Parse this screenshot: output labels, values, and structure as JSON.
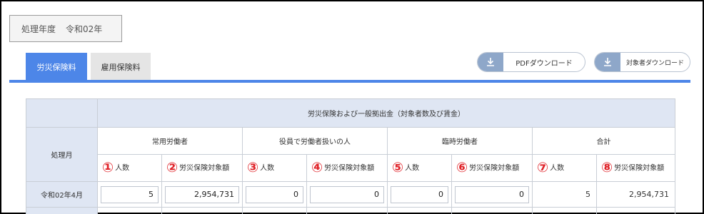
{
  "year_box": {
    "label": "処理年度",
    "value": "令和02年"
  },
  "tabs": [
    {
      "label": "労災保険料",
      "active": true
    },
    {
      "label": "雇用保険料",
      "active": false
    }
  ],
  "buttons": {
    "pdf_download": "PDFダウンロード",
    "target_download": "対象者ダウンロード"
  },
  "table": {
    "row_header": "処理月",
    "group_title": "労災保険および一般拠出金（対象者数及び賃金）",
    "groups": [
      "常用労働者",
      "役員で労働者扱いの人",
      "臨時労働者",
      "合計"
    ],
    "columns": [
      {
        "num": "①",
        "label": "人数"
      },
      {
        "num": "②",
        "label": "労災保険対象額"
      },
      {
        "num": "③",
        "label": "人数"
      },
      {
        "num": "④",
        "label": "労災保険対象額"
      },
      {
        "num": "⑤",
        "label": "人数"
      },
      {
        "num": "⑥",
        "label": "労災保険対象額"
      },
      {
        "num": "⑦",
        "label": "人数"
      },
      {
        "num": "⑧",
        "label": "労災保険対象額"
      }
    ],
    "rows": [
      {
        "month": "令和02年4月",
        "values": [
          "5",
          "2,954,731",
          "0",
          "0",
          "0",
          "0",
          "5",
          "2,954,731"
        ]
      }
    ]
  },
  "colors": {
    "accent": "#4d86e8",
    "header_bg": "#dfe6f3",
    "marker": "#e0242a"
  }
}
